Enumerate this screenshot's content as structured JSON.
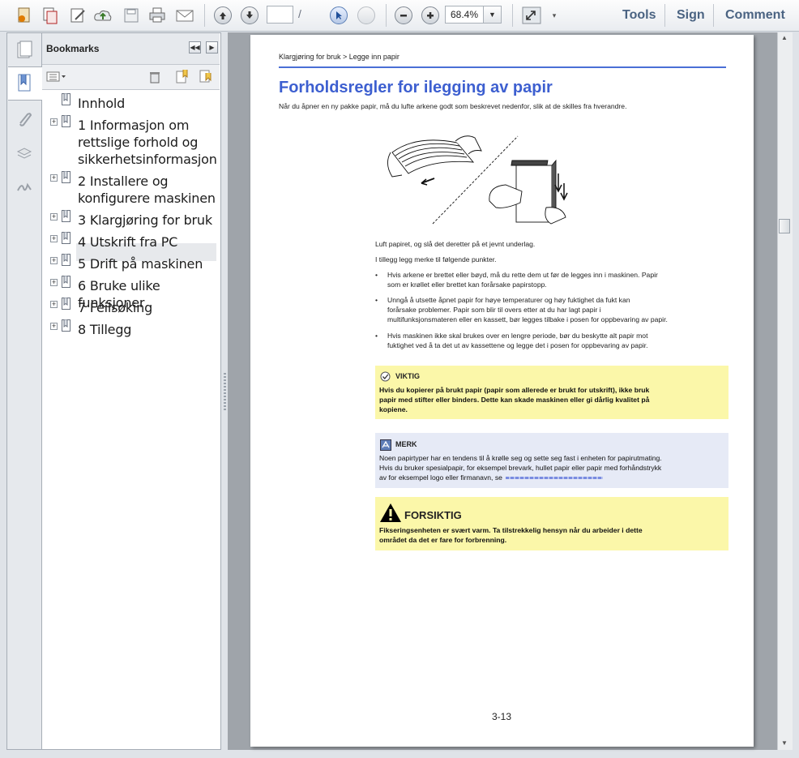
{
  "toolbar": {
    "page_input": "",
    "page_total": "",
    "zoom": "68.4%",
    "tools_label": "Tools",
    "sign_label": "Sign",
    "comment_label": "Comment"
  },
  "bookmarks": {
    "title": "Bookmarks",
    "items": [
      {
        "lines": [
          "Innhold"
        ],
        "expandable": false
      },
      {
        "lines": [
          "1 Informasjon om",
          "rettslige forhold og",
          "sikkerhetsinformasjon"
        ],
        "expandable": true
      },
      {
        "lines": [
          "2 Installere og",
          "konfigurere maskinen"
        ],
        "expandable": true
      },
      {
        "lines": [
          "3 Klargjøring for bruk"
        ],
        "expandable": true,
        "selected": true
      },
      {
        "lines": [
          "4 Utskrift fra PC"
        ],
        "expandable": true
      },
      {
        "lines": [
          "5 Drift på maskinen"
        ],
        "expandable": true
      },
      {
        "lines": [
          "6 Bruke ulike funksjoner"
        ],
        "expandable": true
      },
      {
        "lines": [
          "7 Feilsøking"
        ],
        "expandable": true
      },
      {
        "lines": [
          "8 Tillegg"
        ],
        "expandable": true
      }
    ]
  },
  "document": {
    "breadcrumb": "Klargjøring for bruk > Legge inn papir",
    "title": "Forholdsregler for ilegging av papir",
    "intro": "Når du åpner en ny pakke papir, må du lufte arkene godt som beskrevet nedenfor, slik at de skilles fra hverandre.",
    "caption1": "Luft papiret, og slå det deretter på et jevnt underlag.",
    "caption2": "I tillegg legg merke til følgende punkter.",
    "bullets": [
      [
        "Hvis arkene er brettet eller bøyd, må du rette dem ut før de legges inn i maskinen. Papir",
        "som er krøllet eller brettet kan forårsake papirstopp."
      ],
      [
        "Unngå å utsette åpnet papir for høye temperaturer og høy fuktighet da fukt kan",
        "forårsake problemer. Papir som blir til overs etter at du har lagt papir i",
        "multifunksjonsmateren eller en kassett, bør legges tilbake i posen for oppbevaring av papir."
      ],
      [
        "Hvis maskinen ikke skal brukes over en lengre periode, bør du beskytte alt papir mot",
        "fuktighet ved å ta det ut av kassettene og legge det i posen for oppbevaring av papir."
      ]
    ],
    "viktig_title": "VIKTIG",
    "viktig_lines": [
      "Hvis du kopierer på brukt papir (papir som allerede er brukt for utskrift), ikke bruk",
      "papir med stifter eller binders. Dette kan skade maskinen eller gi dårlig kvalitet på",
      "kopiene."
    ],
    "merk_title": "MERK",
    "merk_lines": [
      "Noen papirtyper har en tendens til å krølle seg og sette seg fast i enheten for papirutmating.",
      "Hvis du bruker spesialpapir, for eksempel brevark, hullet papir eller papir med forhåndstrykk",
      "av for eksempel logo eller firmanavn, se"
    ],
    "forsiktig_title": "FORSIKTIG",
    "forsiktig_lines": [
      "Fikseringsenheten er svært varm. Ta tilstrekkelig hensyn når du arbeider i dette",
      "området da det er fare for forbrenning."
    ],
    "page_number": "3-13"
  }
}
